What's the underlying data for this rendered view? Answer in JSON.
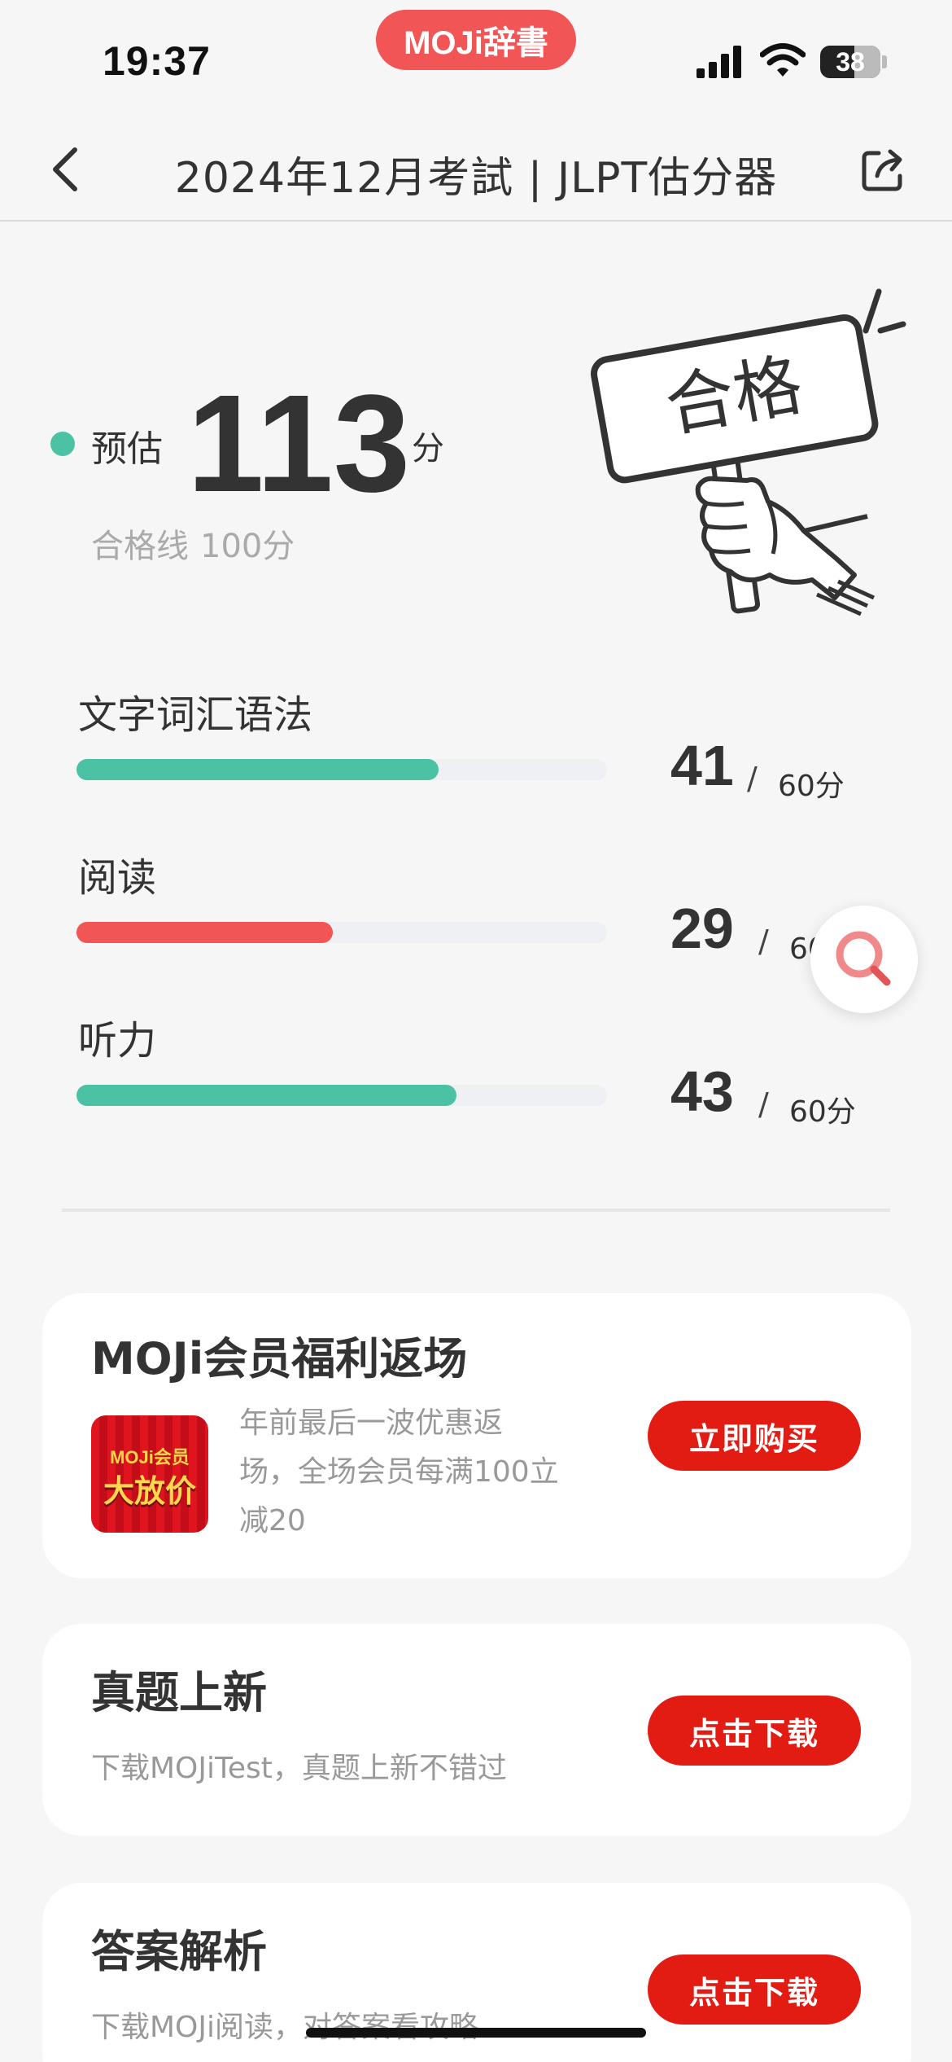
{
  "status_bar": {
    "time": "19:37",
    "app_badge": "MOJi辞書",
    "battery": "38",
    "icons": [
      "signal-icon",
      "wifi-icon",
      "battery-icon"
    ]
  },
  "nav": {
    "title": "2024年12月考試 | JLPT估分器",
    "icons": [
      "back-icon",
      "share-icon"
    ]
  },
  "score": {
    "label": "预估",
    "value": "113",
    "unit": "分",
    "pass_label": "合格线",
    "pass_value": "100分",
    "illustration_text": "合格"
  },
  "sections": [
    {
      "name": "文字词汇语法",
      "score": "41",
      "slash": "/",
      "max": "60分",
      "fraction": 0.683,
      "color": "#4cc2a5"
    },
    {
      "name": "阅读",
      "score": "29",
      "slash": "/",
      "max": "60分",
      "fraction": 0.483,
      "color": "#f25555"
    },
    {
      "name": "听力",
      "score": "43",
      "slash": "/",
      "max": "60分",
      "fraction": 0.717,
      "color": "#4cc2a5"
    }
  ],
  "floating_button": {
    "icon": "search-icon"
  },
  "cards": {
    "promo": {
      "title": "MOJi会员福利返场",
      "desc_lines": [
        "年前最后一波优惠返",
        "场，全场会员每满100立",
        "减20"
      ],
      "button": "立即购买",
      "thumb_top": "MOJi会员",
      "thumb_main": "大放价"
    },
    "exam": {
      "title": "真题上新",
      "desc": "下载MOJiTest，真题上新不错过",
      "button": "点击下载"
    },
    "answer": {
      "title": "答案解析",
      "desc": "下载MOJi阅读，对答案看攻略",
      "button": "点击下载"
    }
  },
  "colors": {
    "accent_green": "#4cc2a5",
    "accent_red": "#f25555",
    "button_red": "#e21b13",
    "background": "#f6f6f6"
  }
}
